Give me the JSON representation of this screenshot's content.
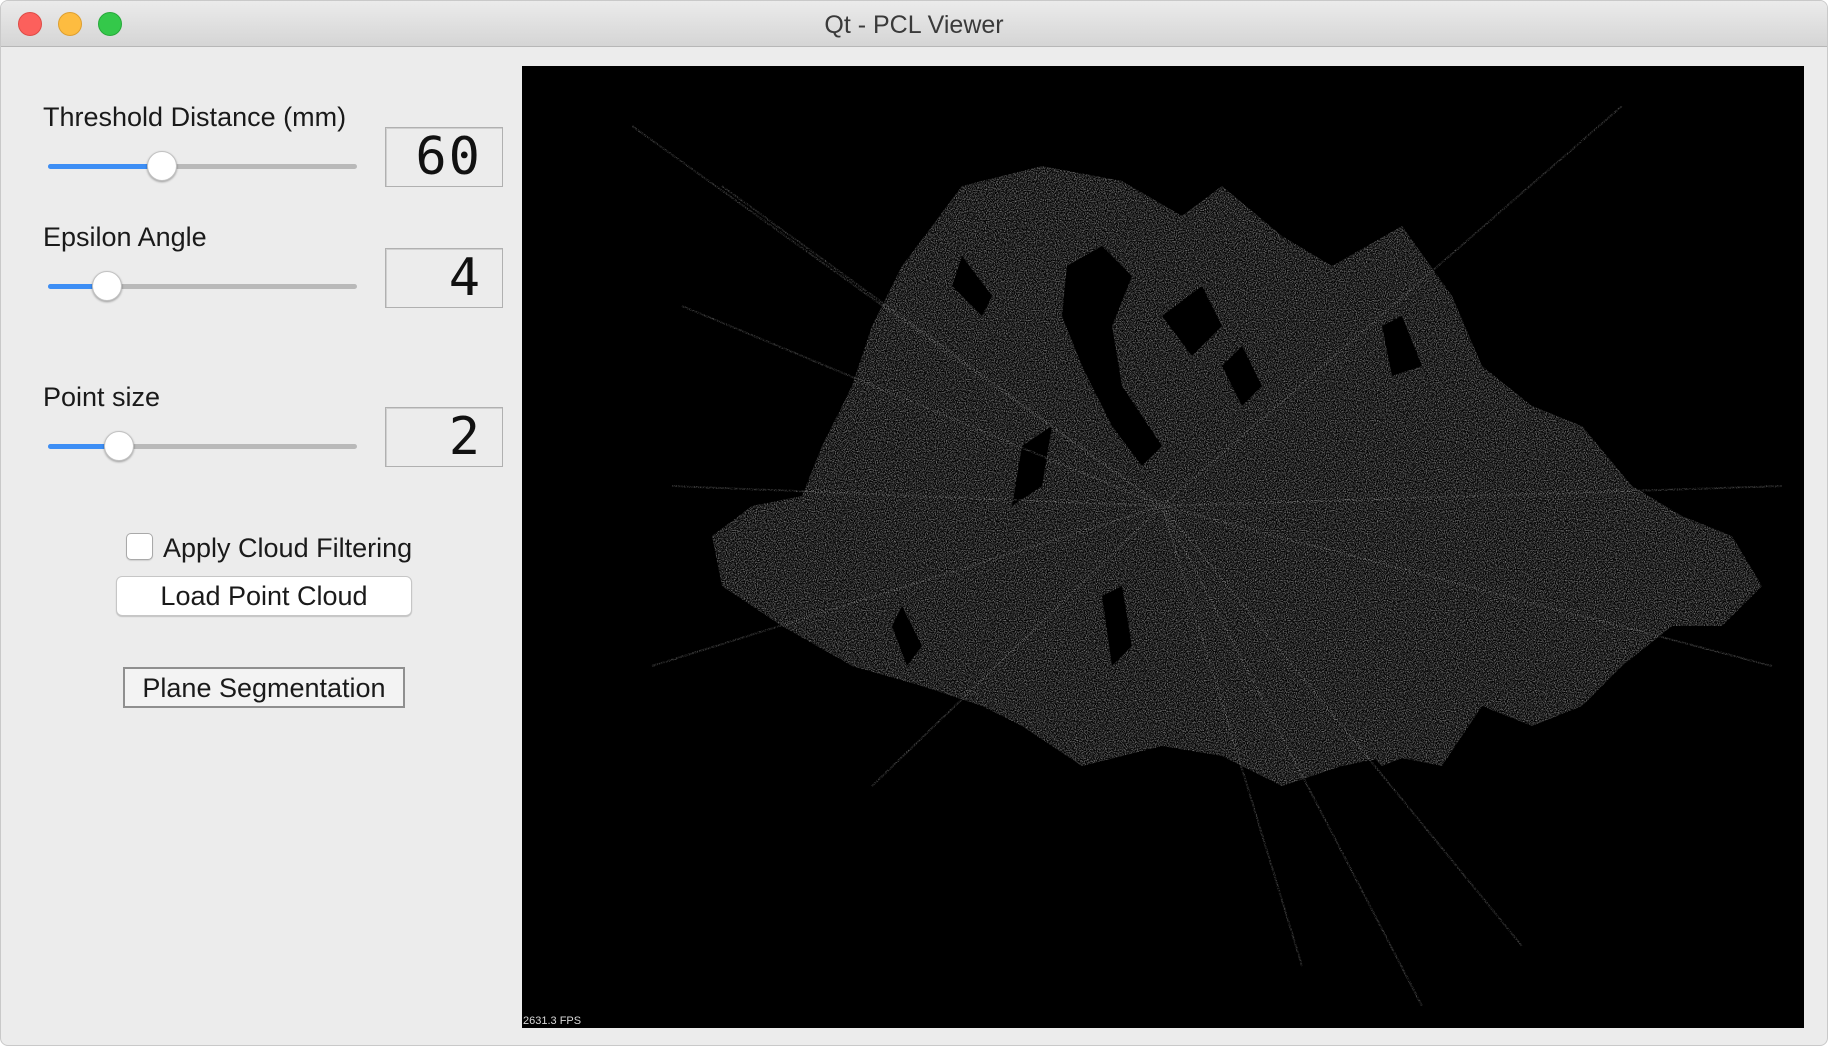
{
  "window": {
    "title": "Qt - PCL Viewer"
  },
  "controls": {
    "threshold": {
      "label": "Threshold Distance (mm)",
      "value": 60,
      "display": "60",
      "slider_fraction": 0.37
    },
    "epsilon": {
      "label": "Epsilon Angle",
      "value": 4,
      "display": "4",
      "slider_fraction": 0.19
    },
    "point_size": {
      "label": "Point size",
      "value": 2,
      "display": "2",
      "slider_fraction": 0.23
    },
    "apply_filtering": {
      "label": "Apply Cloud Filtering",
      "checked": false
    },
    "load_button": {
      "label": "Load Point Cloud"
    },
    "segmentation_button": {
      "label": "Plane Segmentation"
    }
  },
  "viewer": {
    "fps_text": "2631.3 FPS",
    "background_color": "#000000",
    "point_color": "#8c8c8c"
  },
  "colors": {
    "slider_fill": "#3d8ef5",
    "close": "#fc605c",
    "minimize": "#fdbc40",
    "maximize": "#34c84a"
  }
}
